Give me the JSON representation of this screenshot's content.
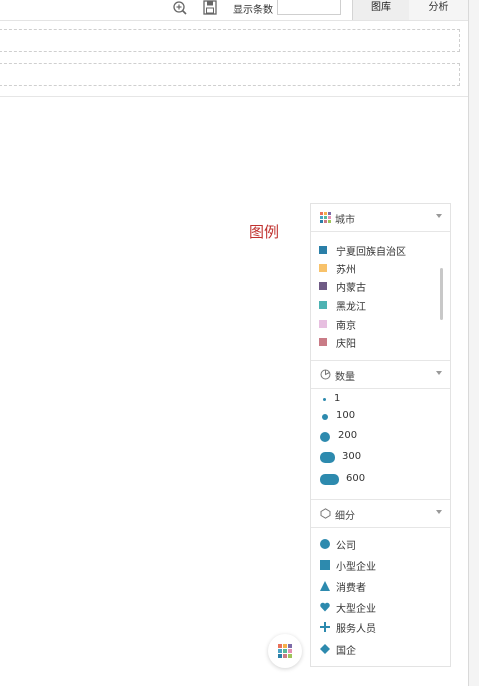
{
  "toolbar": {
    "display_count_label": "显示条数",
    "display_count_value": "",
    "tabs": [
      {
        "label": "图库",
        "active": true
      },
      {
        "label": "分析",
        "active": false
      }
    ]
  },
  "legend_note": "图例",
  "legend": {
    "city": {
      "title": "城市",
      "items": [
        {
          "label": "宁夏回族自治区",
          "color": "#2a7fa8"
        },
        {
          "label": "苏州",
          "color": "#f8c26a"
        },
        {
          "label": "内蒙古",
          "color": "#6f5b85"
        },
        {
          "label": "黑龙江",
          "color": "#4db3b3"
        },
        {
          "label": "南京",
          "color": "#e7bfe0"
        },
        {
          "label": "庆阳",
          "color": "#c97b86"
        }
      ]
    },
    "quantity": {
      "title": "数量",
      "items": [
        {
          "label": "1"
        },
        {
          "label": "100"
        },
        {
          "label": "200"
        },
        {
          "label": "300"
        },
        {
          "label": "600"
        }
      ]
    },
    "segment": {
      "title": "细分",
      "items": [
        {
          "label": "公司",
          "icon": "circle-icon"
        },
        {
          "label": "小型企业",
          "icon": "square-icon"
        },
        {
          "label": "消费者",
          "icon": "triangle-icon"
        },
        {
          "label": "大型企业",
          "icon": "heart-icon"
        },
        {
          "label": "服务人员",
          "icon": "plus-icon"
        },
        {
          "label": "国企",
          "icon": "diamond-icon"
        }
      ]
    }
  },
  "colors": {
    "mark": "#2d8aae",
    "legend_note": "#c0322f"
  }
}
